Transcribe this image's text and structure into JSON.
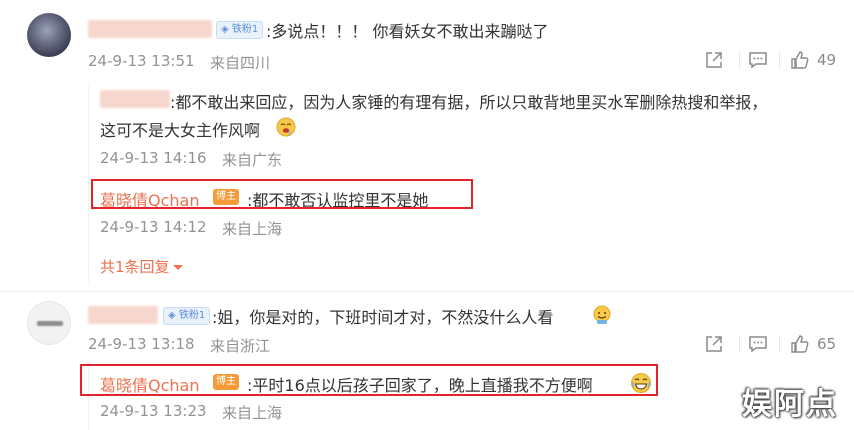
{
  "comments": [
    {
      "colon_text": ":多说点！！！ 你看妖女不敢出来蹦哒了",
      "fan_badge": "◈ 铁粉1",
      "time": "24-9-13 13:51",
      "location": "来自四川",
      "like_count": "49",
      "replies": [
        {
          "text_line1": ":都不敢出来回应，因为人家锤的有理有据，所以只敢背地里买水军删除热搜和举报，",
          "text_line2": "这可不是大女主作风啊",
          "time": "24-9-13 14:16",
          "location": "来自广东"
        },
        {
          "author": "葛晓倩Qchan",
          "host_badge": "博主",
          "text": ":都不敢否认监控里不是她",
          "time": "24-9-13 14:12",
          "location": "来自上海"
        }
      ],
      "more_replies": "共1条回复"
    },
    {
      "colon_text": ":姐，你是对的，下班时间才对，不然没什么人看",
      "fan_badge": "◈ 铁粉1",
      "time": "24-9-13 13:18",
      "location": "来自浙江",
      "like_count": "65",
      "replies": [
        {
          "author": "葛晓倩Qchan",
          "host_badge": "博主",
          "text": ":平时16点以后孩子回家了，晚上直播我不方便啊",
          "time": "24-9-13 13:23",
          "location": "来自上海"
        }
      ]
    }
  ],
  "watermark": "娱阿点",
  "colors": {
    "host_name": "#eb7350",
    "highlight_box": "#e0262b",
    "meta_text": "#939393"
  },
  "icons": [
    "share-icon",
    "comment-icon",
    "like-icon",
    "emoji-drool-icon",
    "emoji-smile-icon",
    "emoji-laugh-icon",
    "caret-down-icon"
  ]
}
